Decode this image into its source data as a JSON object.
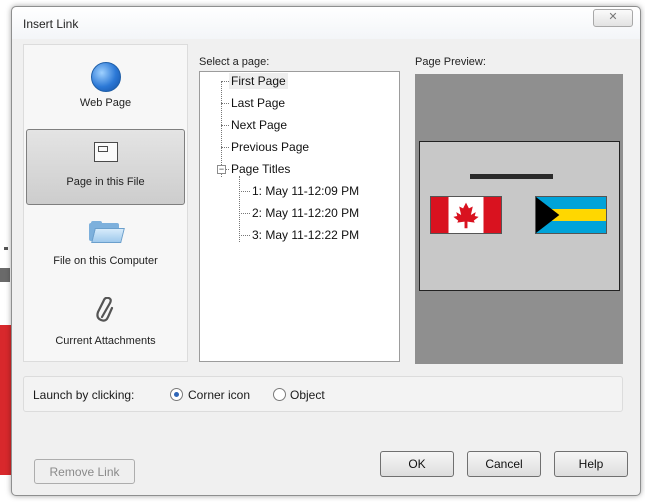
{
  "dialog": {
    "title": "Insert Link",
    "close_glyph": "✕"
  },
  "nav": {
    "items": [
      {
        "label": "Web Page",
        "icon": "globe-icon"
      },
      {
        "label": "Page in this File",
        "icon": "page-icon"
      },
      {
        "label": "File on this Computer",
        "icon": "folder-icon"
      },
      {
        "label": "Current Attachments",
        "icon": "paperclip-icon"
      }
    ],
    "selected": "Page in this File"
  },
  "select_page": {
    "label": "Select a page:",
    "tree": [
      {
        "label": "First Page",
        "selected": true
      },
      {
        "label": "Last Page"
      },
      {
        "label": "Next Page"
      },
      {
        "label": "Previous Page"
      },
      {
        "label": "Page Titles",
        "expanded": true,
        "expander": "−"
      },
      {
        "label": "1: May 11-12:09 PM"
      },
      {
        "label": "2: May 11-12:20 PM"
      },
      {
        "label": "3: May 11-12:22 PM"
      }
    ]
  },
  "preview": {
    "label": "Page Preview:",
    "background": "#8f8f8f",
    "flags": [
      "canada-flag",
      "bahamas-flag"
    ]
  },
  "launch": {
    "label": "Launch by clicking:",
    "options": [
      {
        "label": "Corner icon",
        "checked": true
      },
      {
        "label": "Object",
        "checked": false
      }
    ]
  },
  "buttons": {
    "remove_link": "Remove Link",
    "ok": "OK",
    "cancel": "Cancel",
    "help": "Help"
  }
}
